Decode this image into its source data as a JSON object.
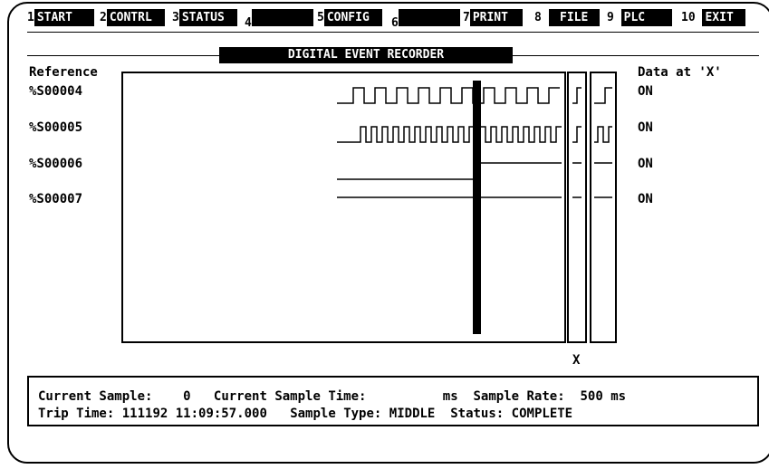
{
  "function_keys": [
    {
      "num": "1",
      "label": "START"
    },
    {
      "num": "2",
      "label": "CONTRL"
    },
    {
      "num": "3",
      "label": "STATUS"
    },
    {
      "num": "4",
      "label": ""
    },
    {
      "num": "5",
      "label": "CONFIG"
    },
    {
      "num": "6",
      "label": ""
    },
    {
      "num": "7",
      "label": "PRINT"
    },
    {
      "num": "8",
      "label": "FILE"
    },
    {
      "num": "9",
      "label": "PLC"
    },
    {
      "num": "10",
      "label": "EXIT"
    }
  ],
  "title": "DIGITAL EVENT RECORDER",
  "reference_header": "Reference",
  "data_header": "Data at 'X'",
  "x_marker": "X",
  "signals": [
    {
      "ref": "%S00004",
      "value": "ON"
    },
    {
      "ref": "%S00005",
      "value": "ON"
    },
    {
      "ref": "%S00006",
      "value": "ON"
    },
    {
      "ref": "%S00007",
      "value": "ON"
    }
  ],
  "status": {
    "current_sample_label": "Current Sample:",
    "current_sample_value": "0",
    "current_sample_time_label": "Current Sample Time:",
    "current_sample_time_unit": "ms",
    "sample_rate_label": "Sample Rate:",
    "sample_rate_value": "500 ms",
    "trip_time_label": "Trip Time:",
    "trip_time_value": "111192 11:09:57.000",
    "sample_type_label": "Sample Type:",
    "sample_type_value": "MIDDLE",
    "status_label": "Status:",
    "status_value": "COMPLETE"
  }
}
